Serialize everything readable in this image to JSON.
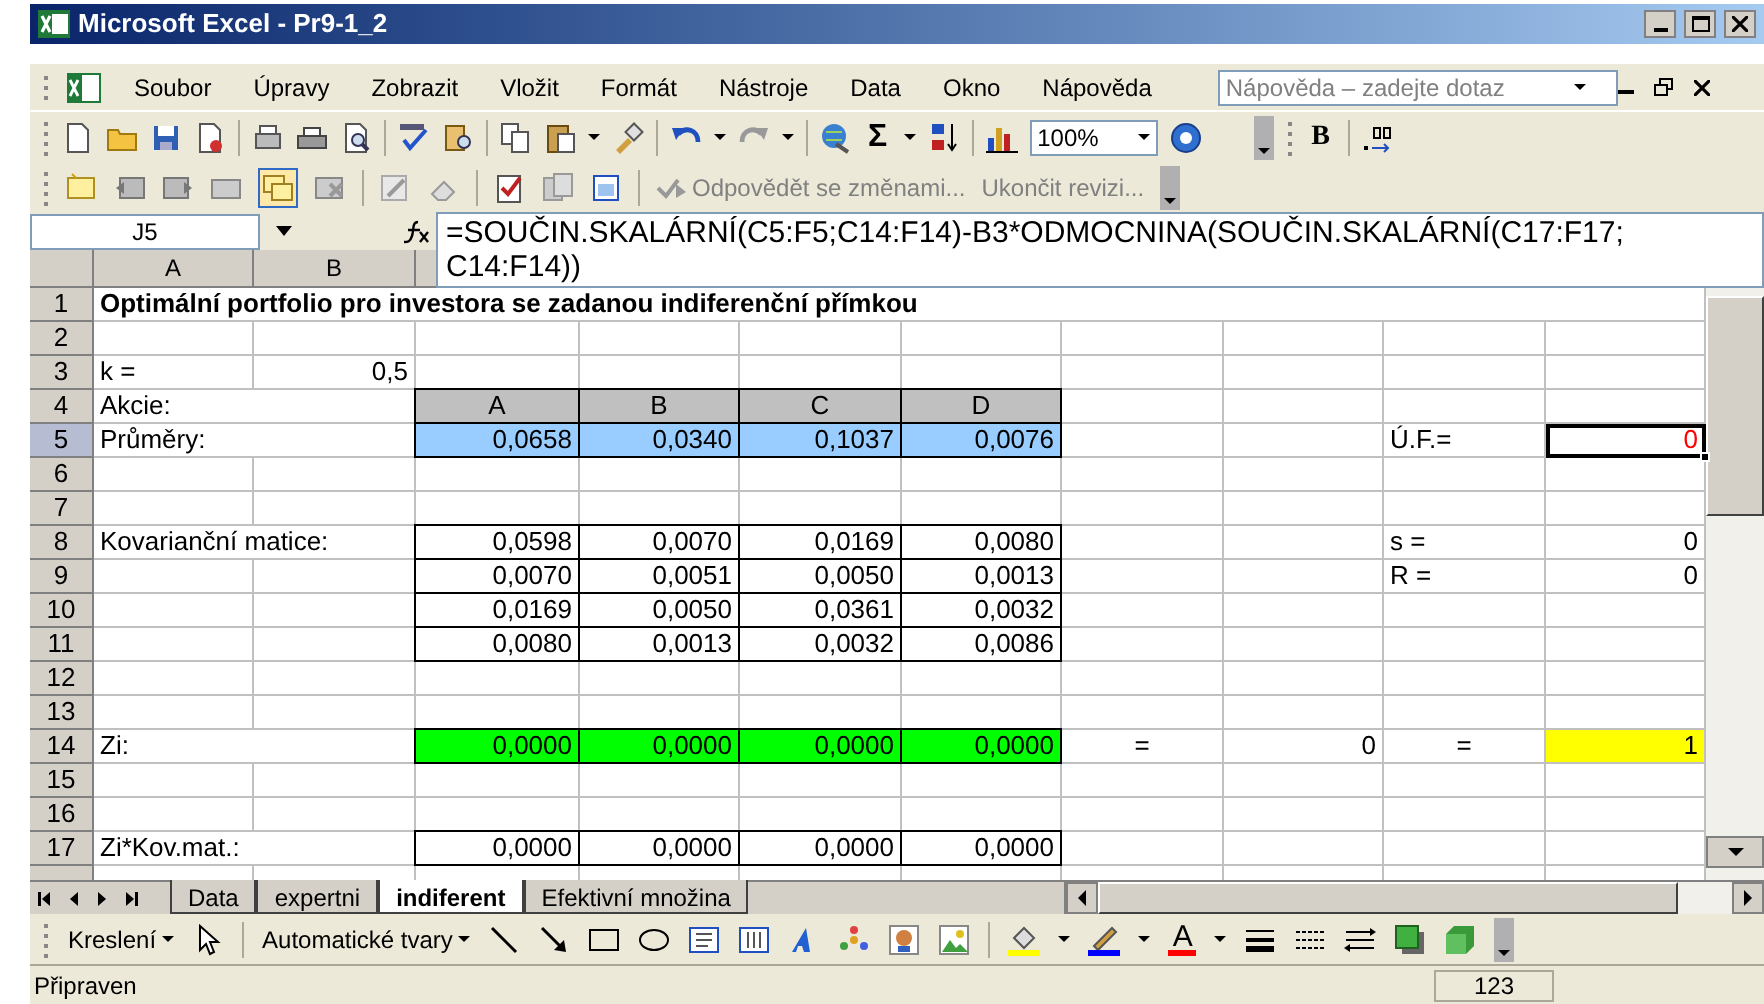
{
  "window": {
    "title": "Microsoft Excel - Pr9-1_2"
  },
  "menu": [
    {
      "label": "Soubor"
    },
    {
      "label": "Úpravy"
    },
    {
      "label": "Zobrazit"
    },
    {
      "label": "Vložit"
    },
    {
      "label": "Formát"
    },
    {
      "label": "Nástroje"
    },
    {
      "label": "Data"
    },
    {
      "label": "Okno"
    },
    {
      "label": "Nápověda"
    }
  ],
  "help_search": {
    "placeholder": "Nápověda – zadejte dotaz"
  },
  "standard_toolbar": {
    "sum_button": "Σ",
    "zoom": "100%",
    "bold_button": "B"
  },
  "reviewing_toolbar": {
    "buttons": [
      {
        "label": "Odpovědět se změnami..."
      },
      {
        "label": "Ukončit revizi..."
      }
    ]
  },
  "formula_bar": {
    "name_box": "J5",
    "formula": "=SOUČIN.SKALÁRNÍ(C5:F5;C14:F14)-B3*ODMOCNINA(SOUČIN.SKALÁRNÍ(C17:F17;C14:F14))"
  },
  "columns": [
    "A",
    "B"
  ],
  "rows": [
    {
      "number": "1",
      "selected": false,
      "cells": [
        {
          "kind": "title",
          "text": "Optimální portfolio pro investora se zadanou indiferenční přímkou",
          "selected": false
        }
      ]
    },
    {
      "number": "2",
      "selected": false,
      "cells": []
    },
    {
      "number": "3",
      "selected": false,
      "cells": [
        {
          "kind": "label",
          "text": "k =",
          "selected": false
        },
        {
          "kind": "number",
          "text": "0,5",
          "selected": false
        }
      ]
    },
    {
      "number": "4",
      "selected": false,
      "cells": [
        {
          "kind": "label",
          "text": "Akcie:",
          "selected": false
        },
        null,
        {
          "kind": "header",
          "text": "A",
          "boxed": true,
          "color": "#c0c0c0",
          "selected": false
        },
        {
          "kind": "header",
          "text": "B",
          "boxed": true,
          "color": "#c0c0c0",
          "selected": false
        },
        {
          "kind": "header",
          "text": "C",
          "boxed": true,
          "color": "#c0c0c0",
          "selected": false
        },
        {
          "kind": "header",
          "text": "D",
          "boxed": true,
          "color": "#c0c0c0",
          "selected": false
        }
      ]
    },
    {
      "number": "5",
      "selected": true,
      "cells": [
        {
          "kind": "label",
          "text": "Průměry:",
          "selected": false
        },
        null,
        {
          "kind": "number",
          "text": "0,0658",
          "boxed": true,
          "color": "#99ccff",
          "selected": false
        },
        {
          "kind": "number",
          "text": "0,0340",
          "boxed": true,
          "color": "#99ccff",
          "selected": false
        },
        {
          "kind": "number",
          "text": "0,1037",
          "boxed": true,
          "color": "#99ccff",
          "selected": false
        },
        {
          "kind": "number",
          "text": "0,0076",
          "boxed": true,
          "color": "#99ccff",
          "selected": false
        },
        null,
        null,
        {
          "kind": "label",
          "text": "Ú.F.=",
          "selected": false
        },
        {
          "kind": "flagged_number",
          "text": "0",
          "selected": true
        }
      ]
    },
    {
      "number": "6",
      "selected": false,
      "cells": []
    },
    {
      "number": "7",
      "selected": false,
      "cells": []
    },
    {
      "number": "8",
      "selected": false,
      "cells": [
        {
          "kind": "label",
          "text": "Kovarianční matice:",
          "selected": false
        },
        null,
        {
          "kind": "number",
          "text": "0,0598",
          "boxed": true,
          "selected": false
        },
        {
          "kind": "number",
          "text": "0,0070",
          "boxed": true,
          "selected": false
        },
        {
          "kind": "number",
          "text": "0,0169",
          "boxed": true,
          "selected": false
        },
        {
          "kind": "number",
          "text": "0,0080",
          "boxed": true,
          "selected": false
        },
        null,
        null,
        {
          "kind": "label",
          "text": "s =",
          "selected": false
        },
        {
          "kind": "number",
          "text": "0",
          "selected": false
        }
      ]
    },
    {
      "number": "9",
      "selected": false,
      "cells": [
        null,
        null,
        {
          "kind": "number",
          "text": "0,0070",
          "boxed": true,
          "selected": false
        },
        {
          "kind": "number",
          "text": "0,0051",
          "boxed": true,
          "selected": false
        },
        {
          "kind": "number",
          "text": "0,0050",
          "boxed": true,
          "selected": false
        },
        {
          "kind": "number",
          "text": "0,0013",
          "boxed": true,
          "selected": false
        },
        null,
        null,
        {
          "kind": "label",
          "text": "R =",
          "selected": false
        },
        {
          "kind": "number",
          "text": "0",
          "selected": false
        }
      ]
    },
    {
      "number": "10",
      "selected": false,
      "cells": [
        null,
        null,
        {
          "kind": "number",
          "text": "0,0169",
          "boxed": true,
          "selected": false
        },
        {
          "kind": "number",
          "text": "0,0050",
          "boxed": true,
          "selected": false
        },
        {
          "kind": "number",
          "text": "0,0361",
          "boxed": true,
          "selected": false
        },
        {
          "kind": "number",
          "text": "0,0032",
          "boxed": true,
          "selected": false
        }
      ]
    },
    {
      "number": "11",
      "selected": false,
      "cells": [
        null,
        null,
        {
          "kind": "number",
          "text": "0,0080",
          "boxed": true,
          "selected": false
        },
        {
          "kind": "number",
          "text": "0,0013",
          "boxed": true,
          "selected": false
        },
        {
          "kind": "number",
          "text": "0,0032",
          "boxed": true,
          "selected": false
        },
        {
          "kind": "number",
          "text": "0,0086",
          "boxed": true,
          "selected": false
        }
      ]
    },
    {
      "number": "12",
      "selected": false,
      "cells": []
    },
    {
      "number": "13",
      "selected": false,
      "cells": []
    },
    {
      "number": "14",
      "selected": false,
      "cells": [
        {
          "kind": "label",
          "text": "Zi:",
          "selected": false
        },
        null,
        {
          "kind": "number",
          "text": "0,0000",
          "boxed": true,
          "color": "#00ff00",
          "selected": false
        },
        {
          "kind": "number",
          "text": "0,0000",
          "boxed": true,
          "color": "#00ff00",
          "selected": false
        },
        {
          "kind": "number",
          "text": "0,0000",
          "boxed": true,
          "color": "#00ff00",
          "selected": false
        },
        {
          "kind": "number",
          "text": "0,0000",
          "boxed": true,
          "color": "#00ff00",
          "selected": false
        },
        {
          "kind": "symbol",
          "text": "=",
          "selected": false
        },
        {
          "kind": "number",
          "text": "0",
          "selected": false
        },
        {
          "kind": "symbol",
          "text": "=",
          "selected": false
        },
        {
          "kind": "number",
          "text": "1",
          "color": "#ffff00",
          "selected": false
        }
      ]
    },
    {
      "number": "15",
      "selected": false,
      "cells": []
    },
    {
      "number": "16",
      "selected": false,
      "cells": []
    },
    {
      "number": "17",
      "selected": false,
      "cells": [
        {
          "kind": "label",
          "text": "Zi*Kov.mat.:",
          "selected": false
        },
        null,
        {
          "kind": "number",
          "text": "0,0000",
          "boxed": true,
          "selected": false
        },
        {
          "kind": "number",
          "text": "0,0000",
          "boxed": true,
          "selected": false
        },
        {
          "kind": "number",
          "text": "0,0000",
          "boxed": true,
          "selected": false
        },
        {
          "kind": "number",
          "text": "0,0000",
          "boxed": true,
          "selected": false
        }
      ]
    }
  ],
  "sheet_tabs": [
    {
      "label": "Data",
      "selected": false
    },
    {
      "label": "expertni",
      "selected": false
    },
    {
      "label": "indiferent",
      "selected": true
    },
    {
      "label": "Efektivní množina",
      "selected": false
    }
  ],
  "drawing_toolbar": {
    "draw_menu": "Kreslení",
    "autoshapes": "Automatické tvary",
    "font_color_button": "A"
  },
  "status_bar": {
    "text": "Připraven",
    "indicator": "123"
  }
}
